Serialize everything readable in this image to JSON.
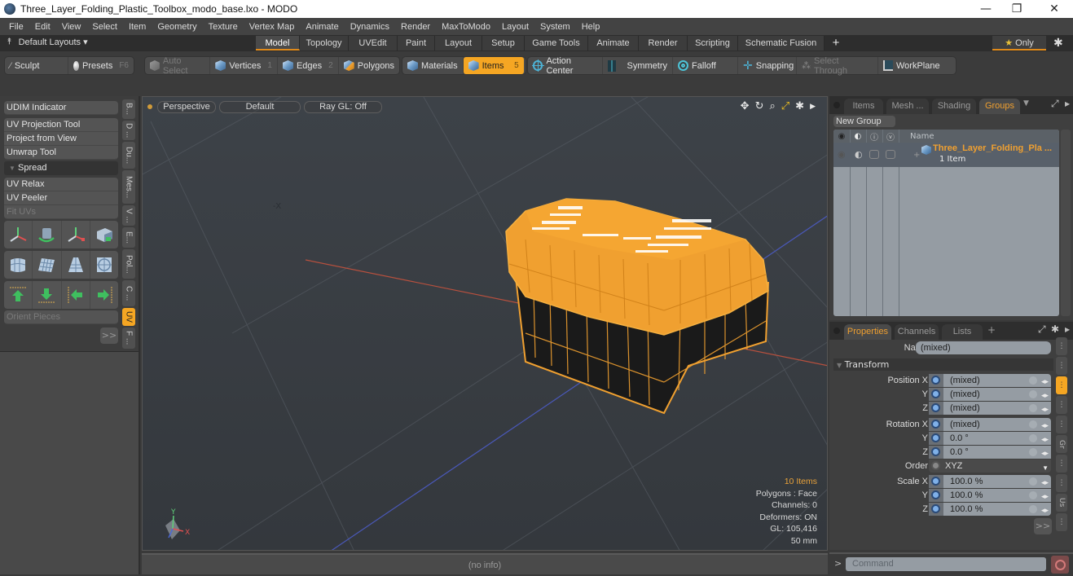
{
  "window": {
    "title": "Three_Layer_Folding_Plastic_Toolbox_modo_base.lxo - MODO",
    "controls": {
      "minimize": "—",
      "restore": "❐",
      "close": "✕"
    }
  },
  "menu": [
    "File",
    "Edit",
    "View",
    "Select",
    "Item",
    "Geometry",
    "Texture",
    "Vertex Map",
    "Animate",
    "Dynamics",
    "Render",
    "MaxToModo",
    "Layout",
    "System",
    "Help"
  ],
  "layoutbar": {
    "default_layouts": "Default Layouts ▾",
    "tabs": [
      "Model",
      "Topology",
      "UVEdit",
      "Paint",
      "Layout",
      "Setup",
      "Game Tools",
      "Animate",
      "Render",
      "Scripting",
      "Schematic Fusion"
    ],
    "active_tab": "Model",
    "add": "+",
    "only": "Only",
    "star": "★"
  },
  "toolbar": {
    "sculpt": "Sculpt",
    "presets": "Presets",
    "presets_key": "F6",
    "auto_select": "Auto Select",
    "vertices": "Vertices",
    "vertices_key": "1",
    "edges": "Edges",
    "edges_key": "2",
    "polygons": "Polygons",
    "materials": "Materials",
    "items": "Items",
    "items_key": "5",
    "action_center": "Action Center",
    "symmetry": "Symmetry",
    "falloff": "Falloff",
    "snapping": "Snapping",
    "select_through": "Select Through",
    "workplane": "WorkPlane"
  },
  "left_panel": {
    "udim": "UDIM Indicator",
    "uv_projection": "UV Projection Tool",
    "project_from_view": "Project from View",
    "unwrap": "Unwrap Tool",
    "spread": "Spread",
    "uv_relax": "UV Relax",
    "uv_peeler": "UV Peeler",
    "fit_uvs": "Fit UVs",
    "orient_pieces": "Orient Pieces",
    "more": ">>",
    "vtabs": [
      "B...",
      "D ...",
      "Du...",
      "Mes...",
      "V ...",
      "E...",
      "Pol...",
      "C ...",
      "UV",
      "F ..."
    ],
    "active_vtab": "UV"
  },
  "viewport": {
    "view": "Perspective",
    "shading": "Default",
    "raygl": "Ray GL: Off",
    "info": {
      "items": "10 Items",
      "polygons": "Polygons : Face",
      "channels": "Channels: 0",
      "deformers": "Deformers: ON",
      "gl": "GL: 105,416",
      "scale": "50 mm"
    },
    "axis_labels": {
      "x": "X",
      "y": "Y",
      "neg_x": "-X"
    }
  },
  "status": "(no info)",
  "groups_panel": {
    "tabs": [
      "Items",
      "Mesh ...",
      "Shading",
      "Groups"
    ],
    "active_tab": "Groups",
    "new_group": "New Group",
    "column_name": "Name",
    "rows": [
      {
        "name": "Three_Layer_Folding_Pla ...",
        "count": "1 Item"
      }
    ]
  },
  "properties_panel": {
    "tabs": [
      "Properties",
      "Channels",
      "Lists"
    ],
    "active_tab": "Properties",
    "add": "+",
    "name_label": "Name",
    "name_value": "(mixed)",
    "section": "Transform",
    "position": {
      "label_x": "Position X",
      "x": "(mixed)",
      "y": "(mixed)",
      "z": "(mixed)"
    },
    "rotation": {
      "label_x": "Rotation X",
      "x": "(mixed)",
      "y": "0.0 °",
      "z": "0.0 °"
    },
    "order_label": "Order",
    "order_value": "XYZ",
    "scale": {
      "label_x": "Scale X",
      "x": "100.0 %",
      "y": "100.0 %",
      "z": "100.0 %"
    },
    "y_label": "Y",
    "z_label": "Z",
    "more": ">>",
    "side_tabs": [
      "⋮",
      "⋮",
      "⋮",
      "⋮",
      "⋮",
      "Gr",
      "⋮",
      "⋮",
      "Us",
      "⋮"
    ]
  },
  "command": {
    "placeholder": "Command",
    "prompt": ">"
  },
  "colors": {
    "accent": "#f5a623",
    "selection": "#f0a030",
    "panel": "#3f3f3f",
    "field": "#959ca3"
  }
}
